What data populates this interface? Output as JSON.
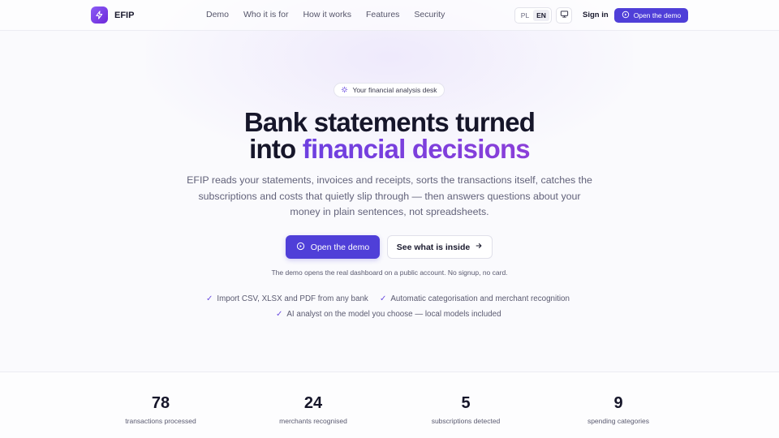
{
  "header": {
    "brand": "EFIP",
    "nav": [
      "Demo",
      "Who it is for",
      "How it works",
      "Features",
      "Security"
    ],
    "lang": {
      "pl": "PL",
      "en": "EN",
      "active": "EN"
    },
    "signin": "Sign in",
    "demo_button": "Open the demo"
  },
  "hero": {
    "eyebrow": "Your financial analysis desk",
    "headline_line1": "Bank statements turned",
    "headline_line2_plain": "into ",
    "headline_line2_accent": "financial decisions",
    "subtext": "EFIP reads your statements, invoices and receipts, sorts the transactions itself, catches the subscriptions and costs that quietly slip through — then answers questions about your money in plain sentences, not spreadsheets.",
    "cta_primary": "Open the demo",
    "cta_secondary": "See what is inside",
    "demo_note": "The demo opens the real dashboard on a public account. No signup, no card.",
    "features": [
      "Import CSV, XLSX and PDF from any bank",
      "Automatic categorisation and merchant recognition",
      "AI analyst on the model you choose — local models included"
    ]
  },
  "stats": [
    {
      "value": "78",
      "label": "transactions processed"
    },
    {
      "value": "24",
      "label": "merchants recognised"
    },
    {
      "value": "5",
      "label": "subscriptions detected"
    },
    {
      "value": "9",
      "label": "spending categories"
    }
  ],
  "colors": {
    "accent": "#4f3fd8",
    "accent_gradient_start": "#6d3fe0",
    "accent_gradient_end": "#8b3fd9",
    "text": "#16162a",
    "muted": "#5a5a70"
  },
  "icons": {
    "brand": "lightning-icon",
    "display": "monitor-icon",
    "play": "play-circle-icon",
    "sparkle": "sparkle-icon",
    "arrow": "arrow-right-icon",
    "check": "check-icon"
  }
}
